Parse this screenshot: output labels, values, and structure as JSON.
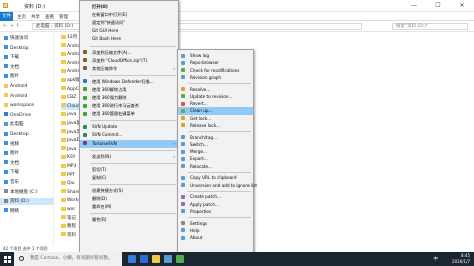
{
  "window": {
    "title": "资料 (D:)",
    "file_tab": "文件",
    "ribbon_tabs": [
      "主页",
      "共享",
      "查看",
      "管理"
    ],
    "address": "此电脑 › 资料 (D:)",
    "search_placeholder": "搜索\"资料 (D:)\"",
    "status": "42 个项目   选中 1 个项目"
  },
  "nav_pane": [
    {
      "label": "快速访问",
      "selected": false
    },
    {
      "label": "Desktop",
      "selected": false
    },
    {
      "label": "下载",
      "selected": false
    },
    {
      "label": "文档",
      "selected": false
    },
    {
      "label": "图片",
      "selected": false
    },
    {
      "label": "Android",
      "selected": false
    },
    {
      "label": "Android",
      "selected": false
    },
    {
      "label": "workspace",
      "selected": false
    },
    {
      "label": "OneDrive",
      "selected": false
    },
    {
      "label": "此电脑",
      "selected": false
    },
    {
      "label": "Desktop",
      "selected": false
    },
    {
      "label": "视频",
      "selected": false
    },
    {
      "label": "图片",
      "selected": false
    },
    {
      "label": "文档",
      "selected": false
    },
    {
      "label": "下载",
      "selected": false
    },
    {
      "label": "音乐",
      "selected": false
    },
    {
      "label": "本地磁盘 (C:)",
      "selected": false
    },
    {
      "label": "资料 (D:)",
      "selected": true
    },
    {
      "label": "网络",
      "selected": false
    }
  ],
  "files": [
    {
      "name": "12月",
      "selected": false
    },
    {
      "name": "Andro",
      "selected": false
    },
    {
      "name": "Andro",
      "selected": false
    },
    {
      "name": "Andro",
      "selected": false
    },
    {
      "name": "Andro",
      "selected": false
    },
    {
      "name": "apk版",
      "selected": false
    },
    {
      "name": "AppCo",
      "selected": false
    },
    {
      "name": "CBZ",
      "selected": false
    },
    {
      "name": "Cloud",
      "selected": true
    },
    {
      "name": "java",
      "selected": false
    },
    {
      "name": "java基",
      "selected": false
    },
    {
      "name": "java实",
      "selected": false
    },
    {
      "name": "JavaE",
      "selected": false
    },
    {
      "name": "Java",
      "selected": false
    },
    {
      "name": "KSY",
      "selected": false
    },
    {
      "name": "MP3",
      "selected": false
    },
    {
      "name": "PPT",
      "selected": false
    },
    {
      "name": "Qiu",
      "selected": false
    },
    {
      "name": "Share",
      "selected": false
    },
    {
      "name": "Works",
      "selected": false
    },
    {
      "name": "wor",
      "selected": false
    },
    {
      "name": "笔记",
      "selected": false
    },
    {
      "name": "教程",
      "selected": false
    },
    {
      "name": "资料",
      "selected": false
    }
  ],
  "context_menu": [
    {
      "label": "打开(O)",
      "bold": true
    },
    {
      "label": "在新窗口中打开(E)"
    },
    {
      "label": "固定到\"快速访问\""
    },
    {
      "label": "Git GUI Here"
    },
    {
      "label": "Git Bash Here"
    },
    {
      "sep": true
    },
    {
      "label": "添加到压缩文件(A)..."
    },
    {
      "label": "添加到 \"CloudOffice.zip\"(T)"
    },
    {
      "label": "其他压缩命令",
      "arrow": true
    },
    {
      "sep": true
    },
    {
      "label": "使用 Windows Defender扫描..."
    },
    {
      "label": "使用 360解除占用"
    },
    {
      "label": "使用 360强力删除"
    },
    {
      "label": "使用 360进行木马云查杀"
    },
    {
      "label": "使用 360管理右键菜单"
    },
    {
      "sep": true
    },
    {
      "label": "SVN Update"
    },
    {
      "label": "SVN Commit..."
    },
    {
      "label": "TortoiseSVN",
      "arrow": true,
      "highlight": true
    },
    {
      "sep": true
    },
    {
      "label": "发送到(N)",
      "arrow": true
    },
    {
      "sep": true
    },
    {
      "label": "剪切(T)"
    },
    {
      "label": "复制(C)"
    },
    {
      "sep": true
    },
    {
      "label": "创建快捷方式(S)"
    },
    {
      "label": "删除(D)"
    },
    {
      "label": "重命名(M)"
    },
    {
      "sep": true
    },
    {
      "label": "属性(R)"
    }
  ],
  "svn_menu": [
    {
      "label": "Show log"
    },
    {
      "label": "Repo-browser"
    },
    {
      "label": "Check for modifications"
    },
    {
      "label": "Revision graph"
    },
    {
      "sep": true
    },
    {
      "label": "Resolve..."
    },
    {
      "label": "Update to revision..."
    },
    {
      "label": "Revert..."
    },
    {
      "label": "Clean up...",
      "highlight": true
    },
    {
      "label": "Get lock..."
    },
    {
      "label": "Release lock..."
    },
    {
      "sep": true
    },
    {
      "label": "Branch/tag..."
    },
    {
      "label": "Switch..."
    },
    {
      "label": "Merge..."
    },
    {
      "label": "Export..."
    },
    {
      "label": "Relocate..."
    },
    {
      "sep": true
    },
    {
      "label": "Copy URL to clipboard"
    },
    {
      "label": "Unversion and add to ignore list",
      "arrow": true
    },
    {
      "sep": true
    },
    {
      "label": "Create patch..."
    },
    {
      "label": "Apply patch..."
    },
    {
      "label": "Properties"
    },
    {
      "sep": true
    },
    {
      "label": "Settings"
    },
    {
      "label": "Help"
    },
    {
      "label": "About"
    }
  ],
  "taskbar": {
    "search_text": "我是 Cortana，小娜。有问题尽管问我。",
    "time": "8:45",
    "date": "2016/1/7",
    "lang": "中"
  },
  "colors": {
    "menu_highlight": "#91c9f7",
    "selection": "#cce8ff",
    "taskbar": "#1c2630",
    "folder": "#f3c84b"
  }
}
